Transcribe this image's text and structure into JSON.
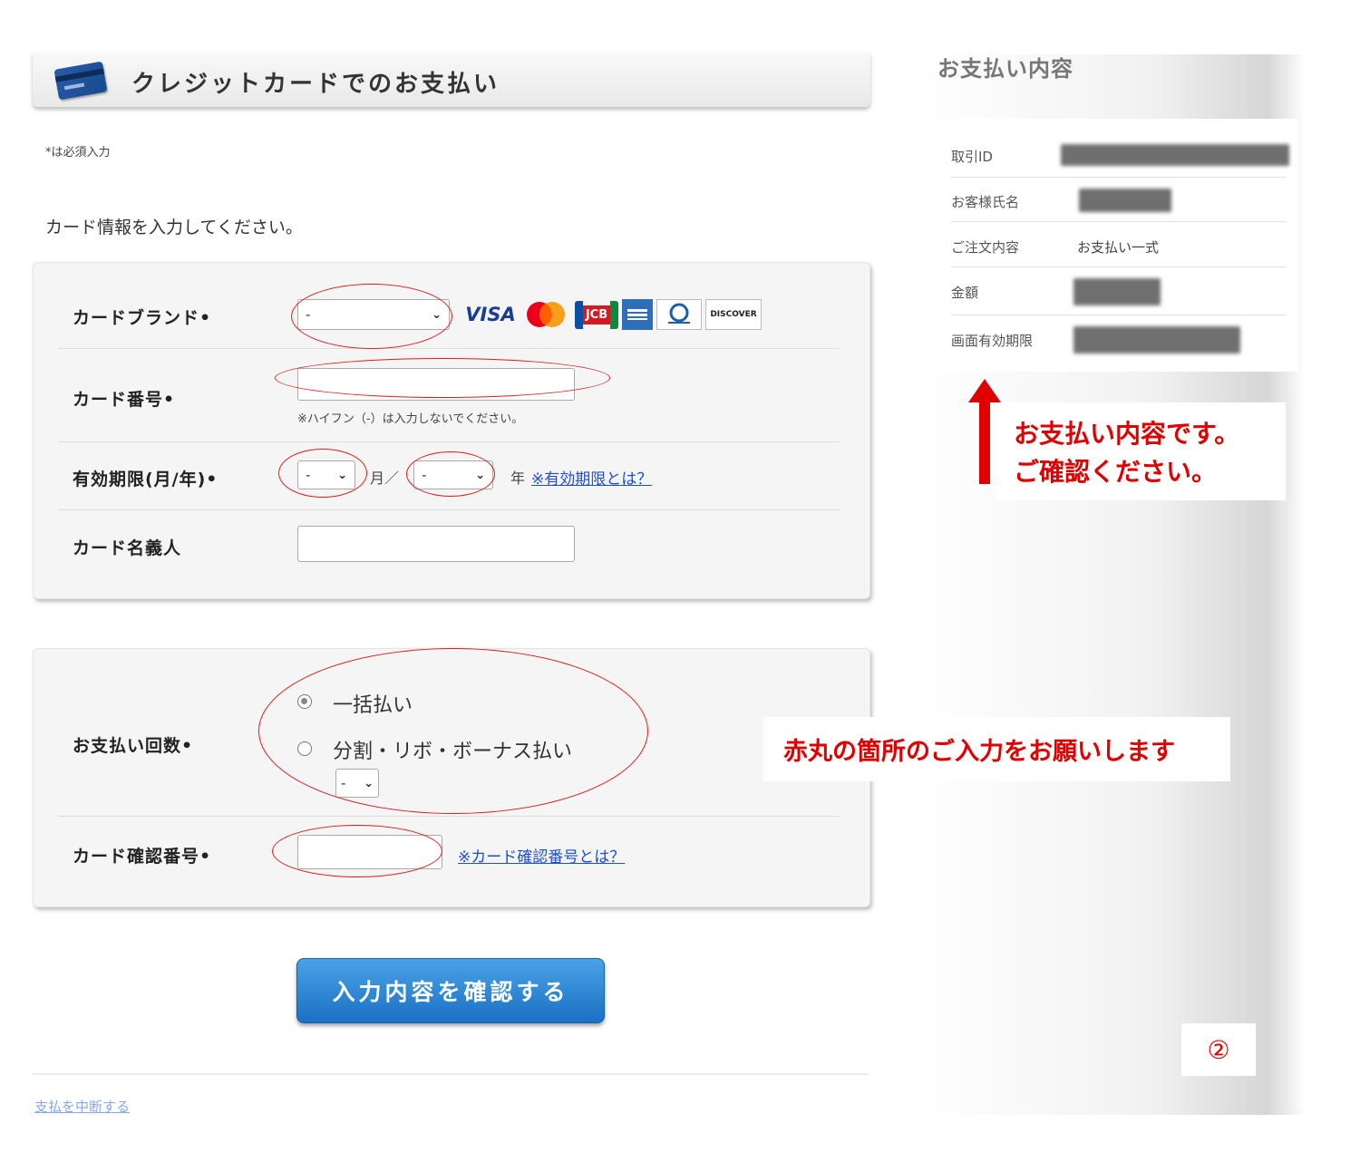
{
  "header": {
    "title": "クレジットカードでのお支払い"
  },
  "required_note": "*は必須入力",
  "instruction": "カード情報を入力してください。",
  "form": {
    "card_brand": {
      "label": "カードブランド•",
      "selected": "-",
      "logos": [
        "VISA",
        "JCB",
        "DISCOVER"
      ]
    },
    "card_number": {
      "label": "カード番号•",
      "value": "",
      "hint": "※ハイフン（-）は入力しないでください。"
    },
    "expiry": {
      "label": "有効期限(月/年)•",
      "month_selected": "-",
      "month_suffix": "月／",
      "year_selected": "-",
      "year_suffix": "年",
      "help_link": "※有効期限とは？"
    },
    "card_holder": {
      "label": "カード名義人",
      "value": ""
    },
    "installments": {
      "label": "お支払い回数•",
      "options": [
        {
          "label": "一括払い",
          "checked": true
        },
        {
          "label": "分割・リボ・ボーナス払い",
          "checked": false
        }
      ],
      "count_selected": "-"
    },
    "security_code": {
      "label": "カード確認番号•",
      "value": "",
      "help_link": "※カード確認番号とは？"
    }
  },
  "confirm_button": "入力内容を確認する",
  "cancel_link": "支払を中断する",
  "summary": {
    "title": "お支払い内容",
    "rows": [
      {
        "label": "取引ID"
      },
      {
        "label": "お客様氏名"
      },
      {
        "label": "ご注文内容",
        "value": "お支払い一式"
      },
      {
        "label": "金額"
      },
      {
        "label": "画面有効期限"
      }
    ]
  },
  "annotations": {
    "summary_note_line1": "お支払い内容です。",
    "summary_note_line2": "ご確認ください。",
    "input_note": "赤丸の箇所のご入力をお願いします",
    "step": "②",
    "color": "#e00000"
  }
}
